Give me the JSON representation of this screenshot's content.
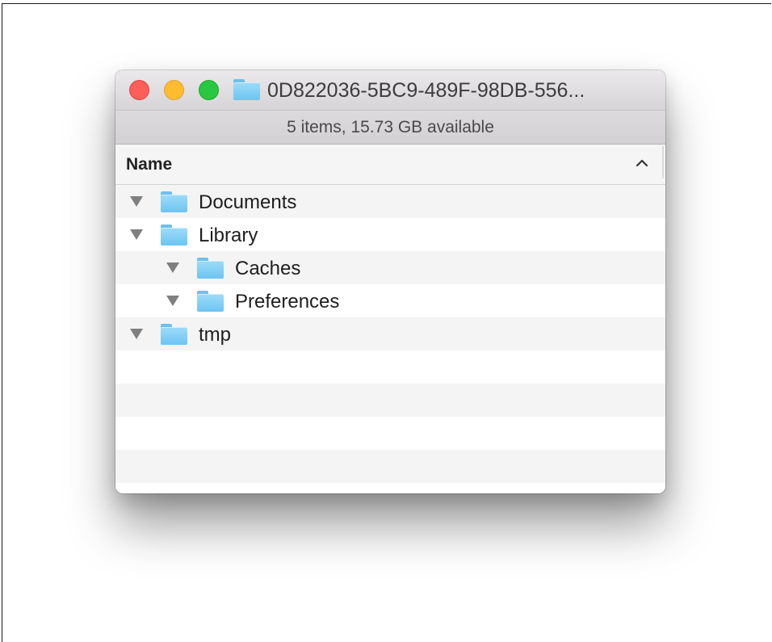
{
  "window": {
    "title": "0D822036-5BC9-489F-98DB-556...",
    "status": "5 items, 15.73 GB available"
  },
  "traffic_lights": {
    "close_color": "#fd5e57",
    "minimize_color": "#febc2e",
    "zoom_color": "#28c840"
  },
  "column_header": {
    "name_label": "Name",
    "sort": "ascending"
  },
  "rows": [
    {
      "label": "Documents",
      "icon": "folder-icon",
      "level": 0,
      "expanded": true
    },
    {
      "label": "Library",
      "icon": "folder-icon",
      "level": 0,
      "expanded": true
    },
    {
      "label": "Caches",
      "icon": "folder-icon",
      "level": 1,
      "expanded": true
    },
    {
      "label": "Preferences",
      "icon": "folder-icon",
      "level": 1,
      "expanded": true
    },
    {
      "label": "tmp",
      "icon": "folder-icon",
      "level": 0,
      "expanded": true
    }
  ],
  "colors": {
    "folder": "#7ccdf4",
    "row_stripe": "#f4f4f4"
  }
}
